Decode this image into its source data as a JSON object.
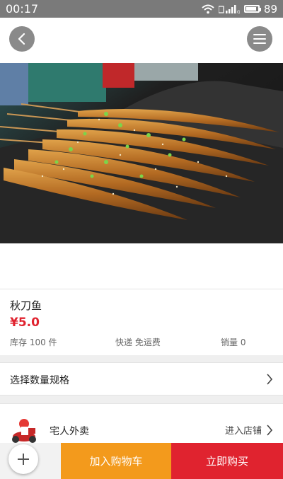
{
  "status_bar": {
    "time": "00:17",
    "battery": "89",
    "battery_level": 0.89
  },
  "product": {
    "name": "秋刀鱼",
    "price": "¥5.0",
    "stock": "库存 100 件",
    "shipping": "快递 免运费",
    "sales": "销量 0"
  },
  "spec": {
    "label": "选择数量规格"
  },
  "shop": {
    "name": "宅人外卖",
    "enter_label": "进入店铺"
  },
  "bottom": {
    "add_to_cart": "加入购物车",
    "buy_now": "立即购买"
  },
  "colors": {
    "accent_red": "#e0232f",
    "cart_orange": "#f39a1c"
  },
  "icons": [
    "back-arrow-icon",
    "hamburger-menu-icon",
    "wifi-icon",
    "signal-icon",
    "battery-icon",
    "chevron-right-icon",
    "plus-icon",
    "shop-logo-icon"
  ]
}
